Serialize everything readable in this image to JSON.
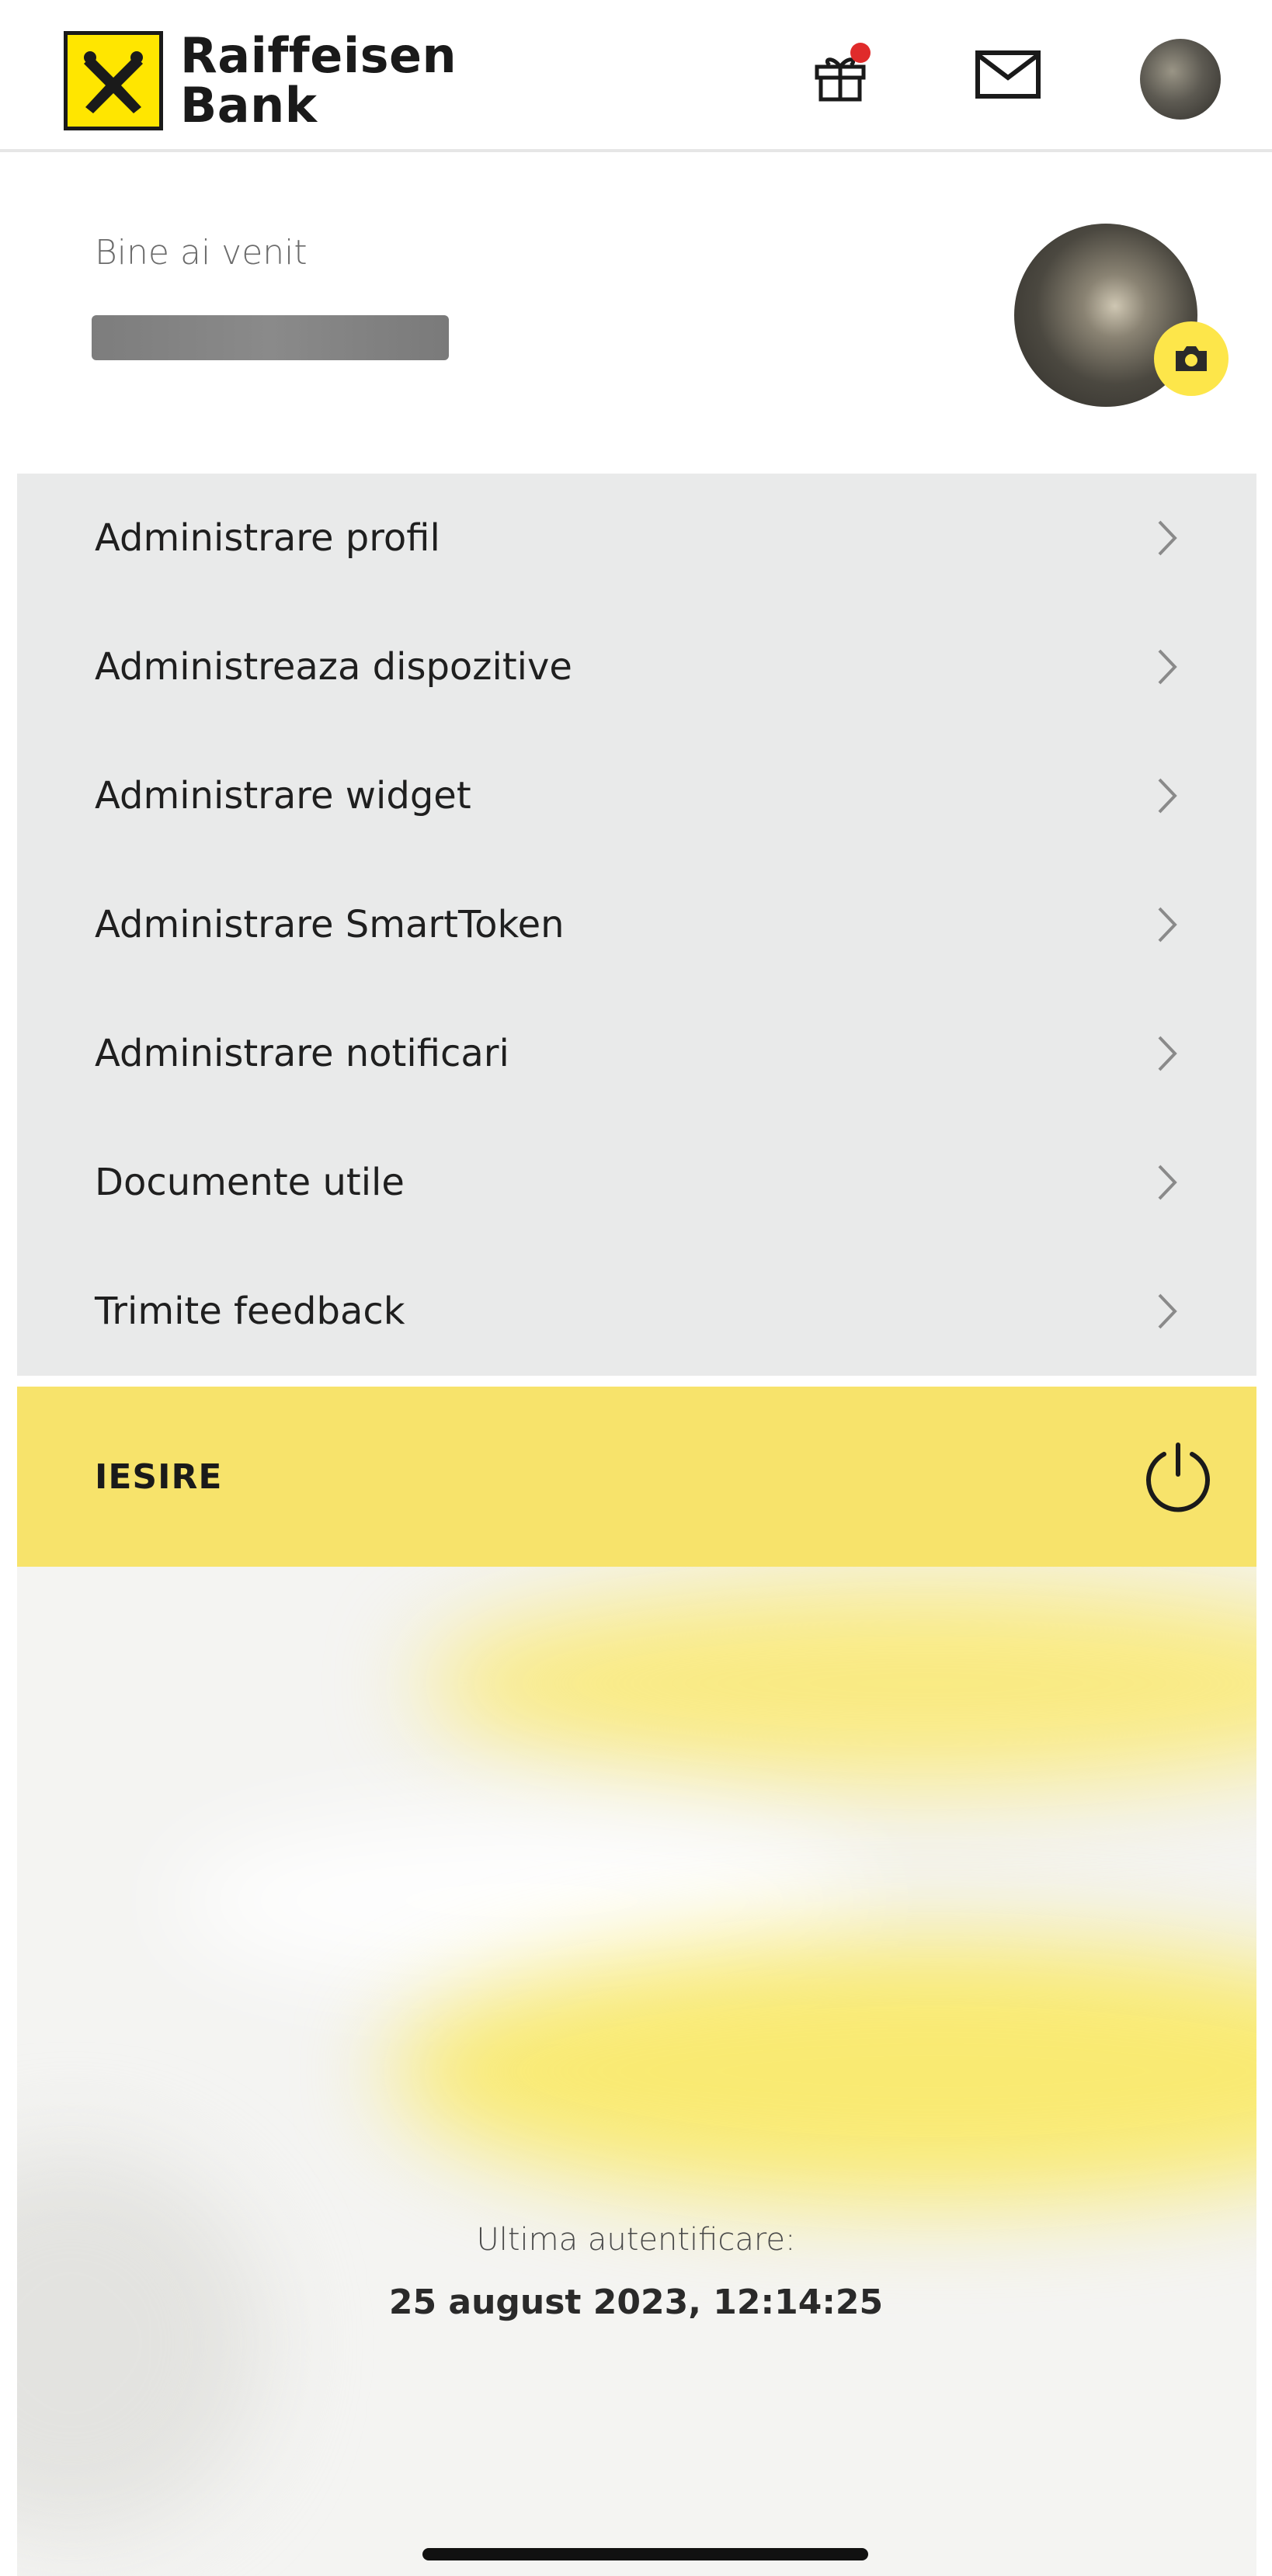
{
  "header": {
    "brand_line1": "Raiffeisen",
    "brand_line2": "Bank",
    "logo_icon": "raiffeisen-crossed-horses-logo",
    "gift_icon": "gift-icon",
    "mail_icon": "envelope-icon",
    "notification_dot_color": "#e02b2b"
  },
  "welcome": {
    "label": "Bine ai venit",
    "camera_icon": "camera-icon"
  },
  "menu": {
    "items": [
      {
        "label": "Administrare profil"
      },
      {
        "label": "Administreaza dispozitive"
      },
      {
        "label": "Administrare widget"
      },
      {
        "label": "Administrare SmartToken"
      },
      {
        "label": "Administrare notificari"
      },
      {
        "label": "Documente utile"
      },
      {
        "label": "Trimite feedback"
      }
    ],
    "chevron_icon": "chevron-right-icon"
  },
  "logout": {
    "label": "IESIRE",
    "icon": "power-icon"
  },
  "last_login": {
    "label": "Ultima autentificare:",
    "value": "25 august 2023, 12:14:25"
  },
  "colors": {
    "accent_yellow": "#f7e36b",
    "brand_yellow": "#ffe600",
    "menu_background": "#e9eaea"
  }
}
